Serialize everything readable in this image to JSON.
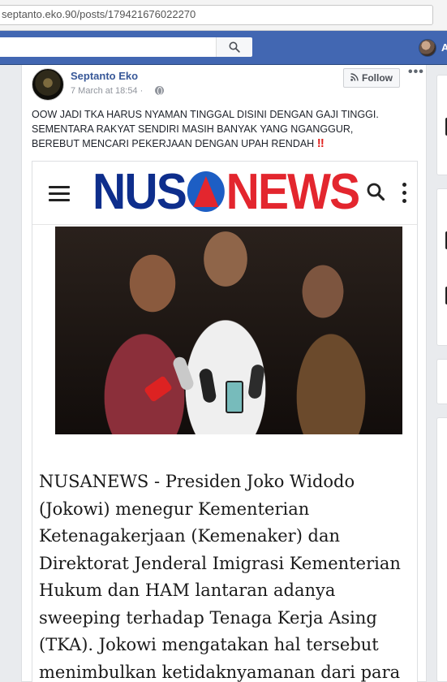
{
  "browser": {
    "url": "septanto.eko.90/posts/179421676022270"
  },
  "topbar": {
    "search_placeholder": "",
    "search_icon": "search-icon",
    "user_initial": "A",
    "brand_color": "#4267b2"
  },
  "post": {
    "author": "Septanto Eko",
    "time": "7 March at 18:54 ·",
    "privacy_icon": "globe-icon",
    "follow_label": "Follow",
    "more_label": "•••",
    "text_lines": [
      "OOW JADI TKA HARUS NYAMAN TINGGAL DISINI DENGAN GAJI TINGGI.",
      "SEMENTARA RAKYAT SENDIRI MASIH BANYAK YANG NGANGGUR,",
      "BEREBUT MENCARI PEKERJAAN DENGAN UPAH RENDAH "
    ],
    "emoji": "‼"
  },
  "embed": {
    "logo_left": "NUS",
    "logo_right": "NEWS",
    "logo_colors": {
      "blue": "#0e2e8c",
      "red": "#e3262e"
    },
    "article_lines": [
      "NUSANEWS - Presiden Joko Widodo",
      "(Jokowi) menegur Kementerian",
      "Ketenagakerjaan (Kemenaker) dan",
      "Direktorat Jenderal Imigrasi Kementerian",
      "Hukum dan HAM lantaran adanya",
      "sweeping terhadap Tenaga Kerja Asing",
      "(TKA). Jokowi mengatakan hal tersebut",
      "menimbulkan ketidaknyamanan dari para"
    ]
  }
}
